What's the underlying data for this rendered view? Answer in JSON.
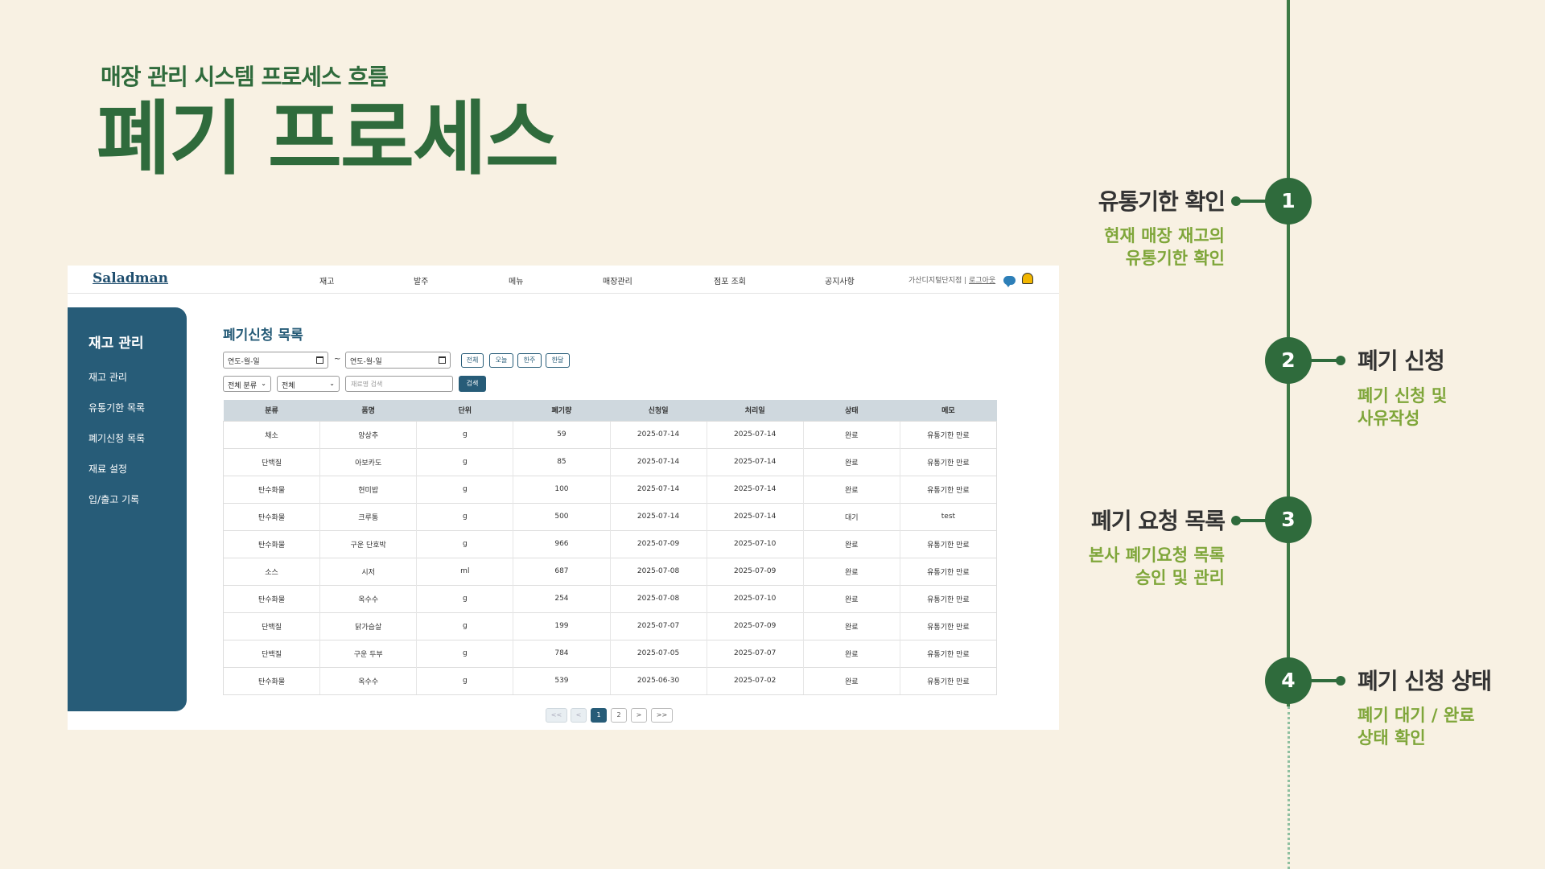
{
  "slide": {
    "subtitle": "매장 관리 시스템 프로세스 흐름",
    "title": "폐기 프로세스"
  },
  "app": {
    "logo": "Saladman",
    "nav": [
      "재고",
      "발주",
      "메뉴",
      "매장관리",
      "점포 조회",
      "공지사항"
    ],
    "store_name": "가산디지털단지점",
    "logout_label": "로그아웃",
    "sidebar": {
      "title": "재고 관리",
      "items": [
        "재고 관리",
        "유통기한 목록",
        "폐기신청 목록",
        "재료 설정",
        "입/출고 기록"
      ]
    },
    "page_title": "폐기신청 목록",
    "filters": {
      "start_date": "연도-월-일",
      "end_date": "연도-월-일",
      "range_sep": "~",
      "range_buttons": [
        "전체",
        "오늘",
        "한주",
        "한달"
      ],
      "category_select": "전체 분류",
      "status_select": "전체",
      "search_placeholder": "재료명 검색",
      "search_button": "검색"
    },
    "table": {
      "headers": [
        "분류",
        "품명",
        "단위",
        "폐기량",
        "신청일",
        "처리일",
        "상태",
        "메모"
      ],
      "rows": [
        [
          "채소",
          "양상추",
          "g",
          "59",
          "2025-07-14",
          "2025-07-14",
          "완료",
          "유통기한 만료"
        ],
        [
          "단백질",
          "아보카도",
          "g",
          "85",
          "2025-07-14",
          "2025-07-14",
          "완료",
          "유통기한 만료"
        ],
        [
          "탄수화물",
          "현미밥",
          "g",
          "100",
          "2025-07-14",
          "2025-07-14",
          "완료",
          "유통기한 만료"
        ],
        [
          "탄수화물",
          "크루통",
          "g",
          "500",
          "2025-07-14",
          "2025-07-14",
          "대기",
          "test"
        ],
        [
          "탄수화물",
          "구운 단호박",
          "g",
          "966",
          "2025-07-09",
          "2025-07-10",
          "완료",
          "유통기한 만료"
        ],
        [
          "소스",
          "시저",
          "ml",
          "687",
          "2025-07-08",
          "2025-07-09",
          "완료",
          "유통기한 만료"
        ],
        [
          "탄수화물",
          "옥수수",
          "g",
          "254",
          "2025-07-08",
          "2025-07-10",
          "완료",
          "유통기한 만료"
        ],
        [
          "단백질",
          "닭가슴살",
          "g",
          "199",
          "2025-07-07",
          "2025-07-09",
          "완료",
          "유통기한 만료"
        ],
        [
          "단백질",
          "구운 두부",
          "g",
          "784",
          "2025-07-05",
          "2025-07-07",
          "완료",
          "유통기한 만료"
        ],
        [
          "탄수화물",
          "옥수수",
          "g",
          "539",
          "2025-06-30",
          "2025-07-02",
          "완료",
          "유통기한 만료"
        ]
      ]
    },
    "pagination": {
      "first": "<<",
      "prev": "<",
      "pages": [
        "1",
        "2"
      ],
      "current_page": "1",
      "next": ">",
      "last": ">>"
    }
  },
  "timeline": {
    "steps": [
      {
        "number": "1",
        "title": "유통기한 확인",
        "desc_line1": "현재 매장 재고의",
        "desc_line2": "유통기한 확인"
      },
      {
        "number": "2",
        "title": "폐기 신청",
        "desc_line1": "폐기 신청 및",
        "desc_line2": "사유작성"
      },
      {
        "number": "3",
        "title": "폐기 요청 목록",
        "desc_line1": "본사 폐기요청 목록",
        "desc_line2": "승인 및 관리"
      },
      {
        "number": "4",
        "title": "폐기 신청 상태",
        "desc_line1": "폐기 대기 / 완료",
        "desc_line2": "상태 확인"
      }
    ]
  },
  "colors": {
    "brand_green": "#2f6b3c",
    "accent_lime": "#7fa63a",
    "app_navy": "#275c78",
    "background": "#f8f1e3"
  }
}
